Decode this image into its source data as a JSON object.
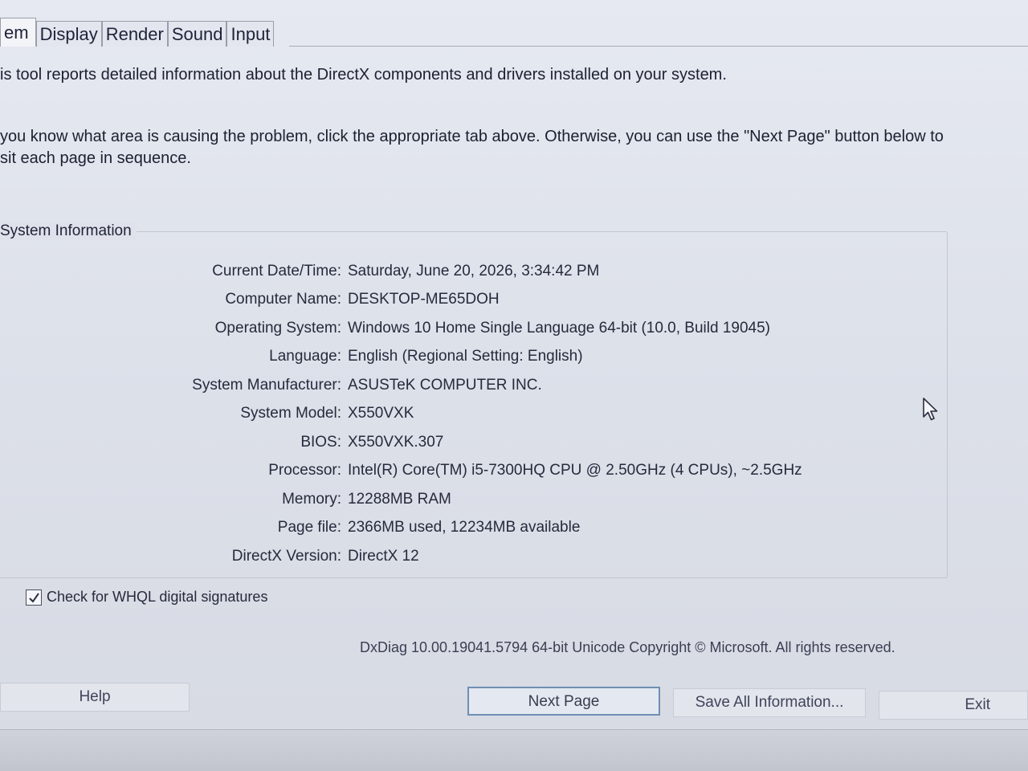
{
  "tabs": [
    {
      "label": "em",
      "active": true
    },
    {
      "label": "Display",
      "active": false
    },
    {
      "label": "Render",
      "active": false
    },
    {
      "label": "Sound",
      "active": false
    },
    {
      "label": "Input",
      "active": false
    }
  ],
  "intro": {
    "line1": "is tool reports detailed information about the DirectX components and drivers installed on your system.",
    "line2a": "you know what area is causing the problem, click the appropriate tab above.  Otherwise, you can use the \"Next Page\" button below to",
    "line2b": "sit each page in sequence."
  },
  "system_info": {
    "title": "System Information",
    "rows": [
      {
        "label": "Current Date/Time:",
        "value": "Saturday, June 20, 2026, 3:34:42 PM"
      },
      {
        "label": "Computer Name:",
        "value": "DESKTOP-ME65DOH"
      },
      {
        "label": "Operating System:",
        "value": "Windows 10 Home Single Language 64-bit (10.0, Build 19045)"
      },
      {
        "label": "Language:",
        "value": "English (Regional Setting: English)"
      },
      {
        "label": "System Manufacturer:",
        "value": "ASUSTeK COMPUTER INC."
      },
      {
        "label": "System Model:",
        "value": "X550VXK"
      },
      {
        "label": "BIOS:",
        "value": "X550VXK.307"
      },
      {
        "label": "Processor:",
        "value": "Intel(R) Core(TM) i5-7300HQ CPU @ 2.50GHz (4 CPUs), ~2.5GHz"
      },
      {
        "label": "Memory:",
        "value": "12288MB RAM"
      },
      {
        "label": "Page file:",
        "value": "2366MB used, 12234MB available"
      },
      {
        "label": "DirectX Version:",
        "value": "DirectX 12"
      }
    ]
  },
  "whql": {
    "label": "Check for WHQL digital signatures",
    "checked": true
  },
  "footer": {
    "copyright": "DxDiag 10.00.19041.5794 64-bit Unicode  Copyright © Microsoft. All rights reserved."
  },
  "buttons": {
    "help": "Help",
    "next": "Next Page",
    "save": "Save All Information...",
    "exit": "Exit"
  },
  "icons": {
    "checkbox": "checkmark-icon",
    "cursor": "mouse-pointer-icon"
  },
  "colors": {
    "focus_border": "#6f8fb4",
    "background": "#dde1ea"
  }
}
